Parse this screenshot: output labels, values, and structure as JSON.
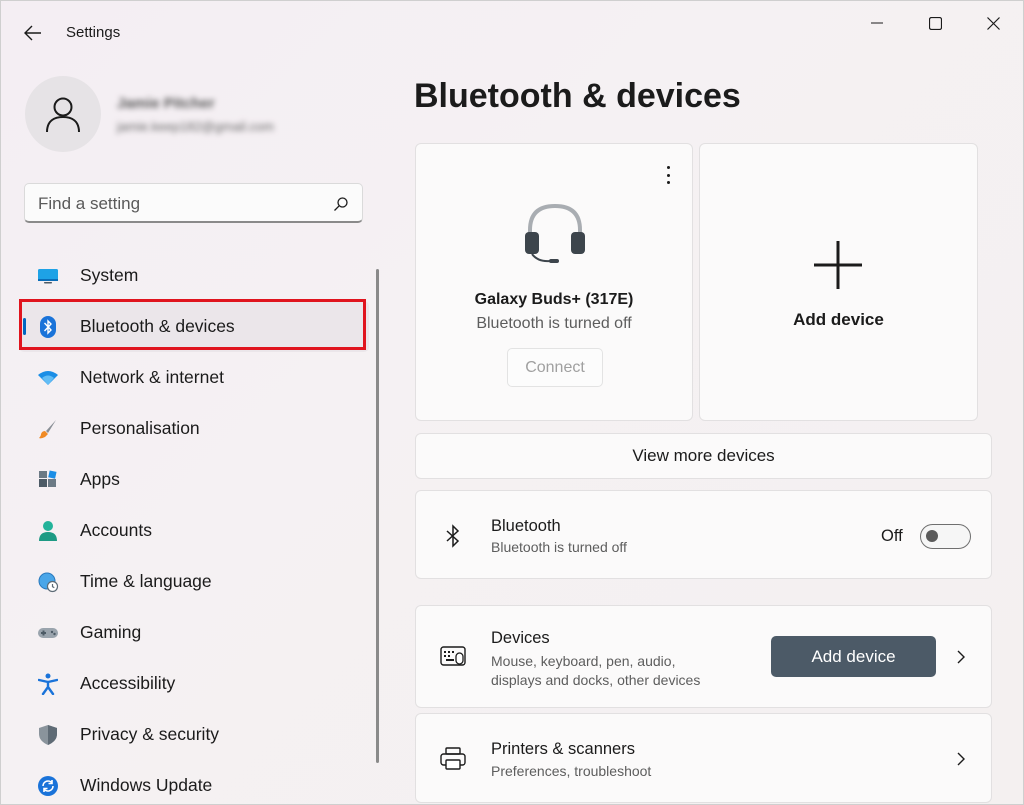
{
  "window": {
    "title": "Settings",
    "controls": [
      "minimize-icon",
      "maximize-icon",
      "close-icon"
    ]
  },
  "profile": {
    "name": "Jamie Pitcher",
    "email": "jamie.keep182@gmail.com"
  },
  "search": {
    "placeholder": "Find a setting",
    "value": ""
  },
  "sidebar": {
    "selected_index": 1,
    "items": [
      {
        "label": "System",
        "icon": "system-display-icon"
      },
      {
        "label": "Bluetooth & devices",
        "icon": "bluetooth-icon"
      },
      {
        "label": "Network & internet",
        "icon": "wifi-icon"
      },
      {
        "label": "Personalisation",
        "icon": "paintbrush-icon"
      },
      {
        "label": "Apps",
        "icon": "apps-icon"
      },
      {
        "label": "Accounts",
        "icon": "accounts-icon"
      },
      {
        "label": "Time & language",
        "icon": "time-language-icon"
      },
      {
        "label": "Gaming",
        "icon": "gamepad-icon"
      },
      {
        "label": "Accessibility",
        "icon": "accessibility-icon"
      },
      {
        "label": "Privacy & security",
        "icon": "shield-icon"
      },
      {
        "label": "Windows Update",
        "icon": "windows-update-icon"
      }
    ]
  },
  "main": {
    "page_title": "Bluetooth & devices",
    "device_card": {
      "name": "Galaxy Buds+ (317E)",
      "status": "Bluetooth is turned off",
      "connect_label": "Connect",
      "icon": "headset-icon"
    },
    "add_card": {
      "label": "Add device",
      "icon": "plus-icon"
    },
    "view_more_label": "View more devices",
    "bluetooth": {
      "title": "Bluetooth",
      "subtitle": "Bluetooth is turned off",
      "toggle_label": "Off",
      "on": false
    },
    "devices": {
      "title": "Devices",
      "subtitle_line1": "Mouse, keyboard, pen, audio,",
      "subtitle_line2": "displays and docks, other devices",
      "button_label": "Add device"
    },
    "printers": {
      "title": "Printers & scanners",
      "subtitle": "Preferences, troubleshoot"
    }
  },
  "colors": {
    "accent": "#0067c0",
    "highlight_box": "#e0141e",
    "primary_button": "#4c5a67"
  }
}
